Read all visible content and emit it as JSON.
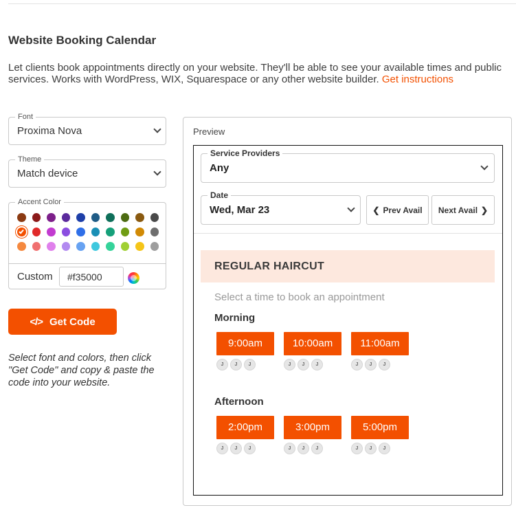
{
  "header": {
    "title": "Website Booking Calendar",
    "description": "Let clients book appointments directly on your website. They'll be able to see your available times and public services. Works with WordPress, WIX, Squarespace or any other website builder.",
    "instructions_link": "Get instructions"
  },
  "settings": {
    "font": {
      "label": "Font",
      "value": "Proxima Nova"
    },
    "theme": {
      "label": "Theme",
      "value": "Match device"
    },
    "accent": {
      "label": "Accent Color",
      "swatch_rows": [
        [
          "#8b3a12",
          "#8b1a1a",
          "#7d1f8a",
          "#5b2a9c",
          "#1e3fa8",
          "#1f5c86",
          "#0f6f5a",
          "#4d6b12",
          "#8a5a10",
          "#4a4a4a"
        ],
        [
          "#f35000",
          "#e02a2a",
          "#c23bd0",
          "#8b4ee0",
          "#2f6fe8",
          "#1a8fb5",
          "#16a07a",
          "#6f9c14",
          "#d18a05",
          "#6e6e6e"
        ],
        [
          "#f5893f",
          "#f07070",
          "#e080ec",
          "#b28af0",
          "#67a2f2",
          "#3ec8de",
          "#35d39a",
          "#a0d033",
          "#f5c518",
          "#9e9e9e"
        ]
      ],
      "selected": "#f35000",
      "custom_label": "Custom",
      "custom_value": "#f35000"
    }
  },
  "get_code": {
    "label": "Get Code",
    "icon": "code-icon"
  },
  "instructions": "Select font and colors, then click \"Get Code\" and copy & paste the code into your website.",
  "preview": {
    "label": "Preview",
    "providers": {
      "label": "Service Providers",
      "value": "Any"
    },
    "date": {
      "label": "Date",
      "value": "Wed, Mar 23"
    },
    "prev_label": "Prev Avail",
    "next_label": "Next Avail",
    "service": "REGULAR HAIRCUT",
    "hint": "Select a time to book an appointment",
    "morning": {
      "title": "Morning",
      "slots": [
        "9:00am",
        "10:00am",
        "11:00am"
      ]
    },
    "afternoon": {
      "title": "Afternoon",
      "slots": [
        "2:00pm",
        "3:00pm",
        "5:00pm"
      ]
    },
    "avatar_initial": "J"
  },
  "colors": {
    "accent": "#f35000",
    "banner": "#fde8de"
  }
}
